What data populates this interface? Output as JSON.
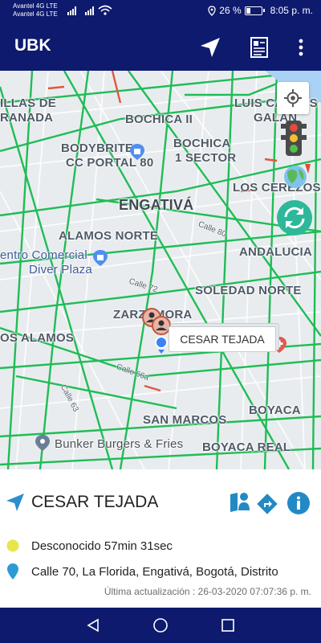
{
  "status_bar": {
    "carrier_1": "Avantel 4G LTE",
    "carrier_2": "Avantel 4G LTE",
    "battery_percent": "26 %",
    "battery_level": 0.26,
    "time": "8:05 p. m.",
    "icons": [
      "signal-icon",
      "wifi-icon",
      "location-icon",
      "battery-icon"
    ]
  },
  "app_bar": {
    "title": "UBK",
    "actions": [
      "navigate-icon",
      "report-icon",
      "more-vert-icon"
    ]
  },
  "map": {
    "labels": {
      "villas_de_granada_1": "ILLAS DE",
      "villas_de_granada_2": "RANADA",
      "bochica_ii": "BOCHICA II",
      "luis_carlos_galan_1": "LUIS CARLOS",
      "luis_carlos_galan_2": "GALAN",
      "bodybrite_1": "BODYBRITE",
      "bodybrite_2": "CC PORTAL 80",
      "bochica_1_1": "BOCHICA",
      "bochica_1_2": "1 SECTOR",
      "los_cerezos": "LOS CEREZOS",
      "engativa": "ENGATIVÁ",
      "calle_80": "Calle 80",
      "alamos_norte": "ALAMOS NORTE",
      "andalucia": "ANDALUCIA",
      "cc_diver_1": "entro Comercial",
      "cc_diver_2": "Diver Plaza",
      "calle_72": "Calle 72",
      "soledad_norte": "SOLEDAD NORTE",
      "zarzamora": "ZARZAMORA",
      "los_alamos": "OS ALAMOS",
      "calle_66a": "Calle 66a",
      "calle_63": "Calle 63",
      "san_marcos": "SAN MARCOS",
      "boyaca": "BOYACA",
      "bunker": "Bunker Burgers & Fries",
      "boyaca_real": "BOYACA REAL"
    },
    "callout_name": "CESAR TEJADA",
    "controls": [
      "my-location-icon",
      "traffic-light-icon",
      "globe-icon",
      "refresh-icon"
    ],
    "colors": {
      "traffic": "#1fbd55",
      "heavy": "#e0573d",
      "road": "#ffffff",
      "background": "#e9ecef"
    }
  },
  "panel": {
    "name": "CESAR TEJADA",
    "status": "Desconocido 57min 31sec",
    "address": "Calle 70, La Florida, Engativá, Bogotá, Distrito",
    "updated": "Última actualización : 26-03-2020 07:07:36 p. m.",
    "colors": {
      "status_dot": "#e6e64a",
      "pin": "#2b9bd6",
      "accent": "#2389c4"
    }
  },
  "nav_bar": {
    "buttons": [
      "back-icon",
      "home-icon",
      "recents-icon"
    ]
  }
}
